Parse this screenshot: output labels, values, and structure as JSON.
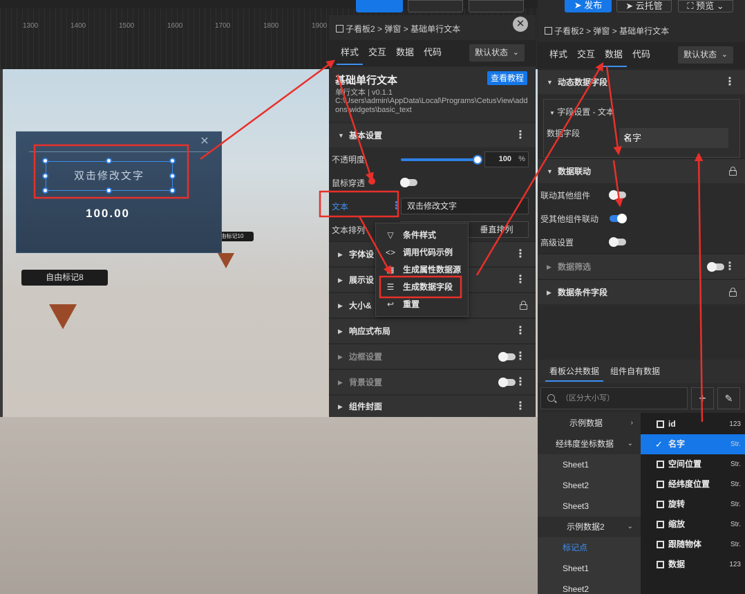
{
  "toolbar": {
    "publish": "发布",
    "cloud_hosting": "云托管",
    "preview": "预览"
  },
  "ruler": {
    "ticks": [
      "1300",
      "1400",
      "1500",
      "1600",
      "1700",
      "1800",
      "1900"
    ]
  },
  "canvas": {
    "widget_text": "双击修改文字",
    "value_text": "100.00",
    "marker_label_1": "自由标记8",
    "marker_label_2": "自由标记10"
  },
  "style_panel": {
    "breadcrumb": [
      "子看板2",
      "弹窗",
      "基础单行文本"
    ],
    "tabs": [
      "样式",
      "交互",
      "数据",
      "代码"
    ],
    "active_tab": "样式",
    "state_select": "默认状态",
    "widget_title": "基础单行文本",
    "tutorial_button": "查看教程",
    "widget_version": "单行文本 | v0.1.1",
    "widget_path": "C:\\Users\\admin\\AppData\\Local\\Programs\\CetusView\\addons\\widgets\\basic_text",
    "basic_settings": "基本设置",
    "opacity_label": "不透明度",
    "opacity_value": "100",
    "opacity_unit": "%",
    "opacity_level": 100,
    "mouse_through_label": "鼠标穿透",
    "text_label": "文本",
    "text_value": "双击修改文字",
    "text_arrange_label": "文本排列",
    "vertical_arrange": "垂直排列",
    "sections": {
      "font": "字体设置",
      "display": "展示设置",
      "size": "大小&位置",
      "responsive": "响应式布局",
      "border": "边框设置",
      "background": "背景设置",
      "cover": "组件封面"
    },
    "font_visible": "字体设",
    "display_visible": "展示设",
    "size_visible": "大小&"
  },
  "context_menu": {
    "items": [
      "条件样式",
      "调用代码示例",
      "生成属性数据源",
      "生成数据字段",
      "重置"
    ]
  },
  "data_panel": {
    "breadcrumb": [
      "子看板2",
      "弹窗",
      "基础单行文本"
    ],
    "tabs": [
      "样式",
      "交互",
      "数据",
      "代码"
    ],
    "active_tab": "数据",
    "state_select": "默认状态",
    "dynamic_fields": "动态数据字段",
    "field_setting_title": "字段设置 - 文本",
    "data_field_label": "数据字段",
    "data_field_value": "名字",
    "data_linkage": "数据联动",
    "link_other": "联动其他组件",
    "linked_by_other": "受其他组件联动",
    "advanced": "高级设置",
    "data_filter": "数据筛选",
    "data_condition_fields": "数据条件字段",
    "bottom_tabs": [
      "看板公共数据",
      "组件自有数据"
    ],
    "search_placeholder": "（区分大小写）",
    "tree": [
      "示例数据",
      "经纬度坐标数据",
      "Sheet1",
      "Sheet2",
      "Sheet3",
      "示例数据2",
      "标记点",
      "Sheet1",
      "Sheet2"
    ],
    "fields": [
      {
        "name": "id",
        "type": "123"
      },
      {
        "name": "名字",
        "type": "Str."
      },
      {
        "name": "空间位置",
        "type": "Str."
      },
      {
        "name": "经纬度位置",
        "type": "Str."
      },
      {
        "name": "旋转",
        "type": "Str."
      },
      {
        "name": "缩放",
        "type": "Str."
      },
      {
        "name": "跟随物体",
        "type": "Str."
      },
      {
        "name": "数据",
        "type": "123"
      }
    ]
  },
  "colors": {
    "accent": "#1677e8",
    "highlight_red": "#e8302a",
    "panel_bg": "#2c2c2c"
  }
}
